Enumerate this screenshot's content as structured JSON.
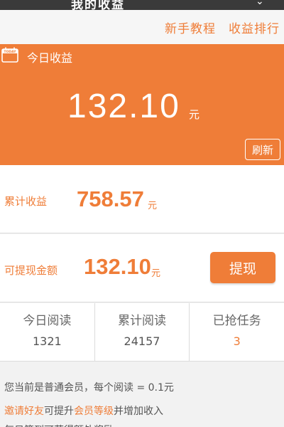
{
  "header": {
    "title": "我的收益",
    "right_icon": "chevron-icon"
  },
  "links": {
    "tutorial": "新手教程",
    "ranking": "收益排行"
  },
  "today_card": {
    "icon": "calendar-today-icon",
    "icon_text": "TODAY",
    "label": "今日收益",
    "value": "132.10",
    "unit": "元",
    "refresh": "刷新"
  },
  "total": {
    "label": "累计收益",
    "value": "758.57",
    "unit": "元"
  },
  "withdraw": {
    "label": "可提现金额",
    "value": "132.10",
    "unit": "元",
    "button": "提现"
  },
  "stats": [
    {
      "label": "今日阅读",
      "value": "1321"
    },
    {
      "label": "累计阅读",
      "value": "24157"
    },
    {
      "label": "已抢任务",
      "value": "3"
    }
  ],
  "notes": {
    "line1": "您当前是普通会员，每个阅读 = 0.1元",
    "line2_link1": "邀请好友",
    "line2_mid": "可提升",
    "line2_link2": "会员等级",
    "line2_end": "并增加收入",
    "line3": "每日签到可获得额外奖励"
  },
  "colors": {
    "accent": "#ef7d38",
    "background": "#f2f2f2"
  }
}
